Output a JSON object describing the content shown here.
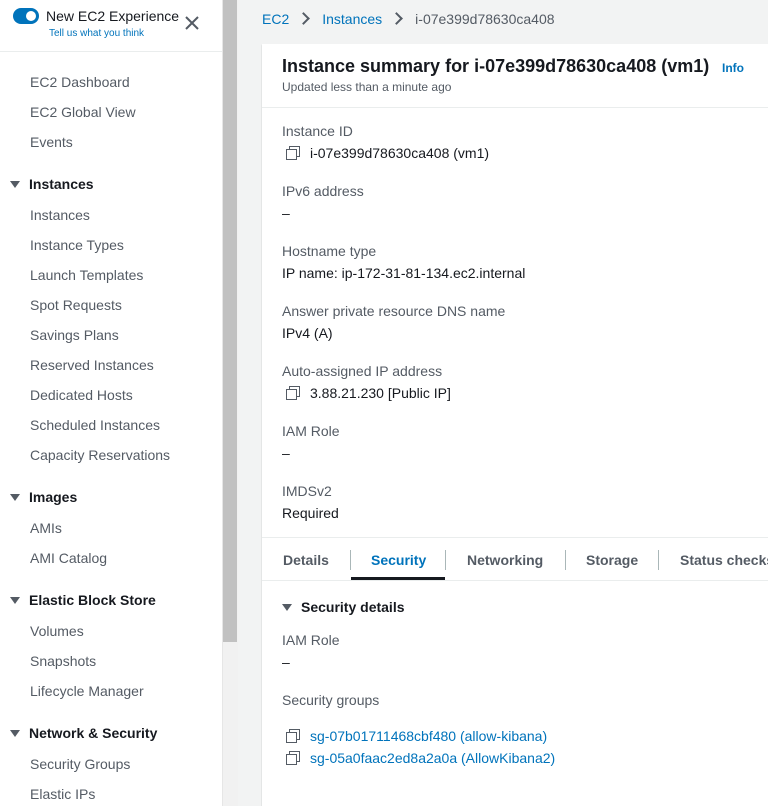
{
  "experience": {
    "title": "New EC2 Experience",
    "subtitle": "Tell us what you think"
  },
  "sidebar": {
    "items_top": [
      "EC2 Dashboard",
      "EC2 Global View",
      "Events"
    ],
    "instances": {
      "heading": "Instances",
      "items": [
        "Instances",
        "Instance Types",
        "Launch Templates",
        "Spot Requests",
        "Savings Plans",
        "Reserved Instances",
        "Dedicated Hosts",
        "Scheduled Instances",
        "Capacity Reservations"
      ]
    },
    "images": {
      "heading": "Images",
      "items": [
        "AMIs",
        "AMI Catalog"
      ]
    },
    "ebs": {
      "heading": "Elastic Block Store",
      "items": [
        "Volumes",
        "Snapshots",
        "Lifecycle Manager"
      ]
    },
    "network": {
      "heading": "Network & Security",
      "items": [
        "Security Groups",
        "Elastic IPs"
      ]
    }
  },
  "breadcrumb": [
    "EC2",
    "Instances",
    "i-07e399d78630ca408"
  ],
  "summary": {
    "title": "Instance summary for i-07e399d78630ca408 (vm1)",
    "info": "Info",
    "updated": "Updated less than a minute ago",
    "fields": [
      {
        "label": "Instance ID",
        "value": "i-07e399d78630ca408 (vm1)",
        "copy": true
      },
      {
        "label": "IPv6 address",
        "value": "–",
        "copy": false
      },
      {
        "label": "Hostname type",
        "value": "IP name: ip-172-31-81-134.ec2.internal",
        "copy": false
      },
      {
        "label": "Answer private resource DNS name",
        "value": "IPv4 (A)",
        "copy": false
      },
      {
        "label": "Auto-assigned IP address",
        "value": "3.88.21.230 [Public IP]",
        "copy": true
      },
      {
        "label": "IAM Role",
        "value": "–",
        "copy": false
      },
      {
        "label": "IMDSv2",
        "value": "Required",
        "copy": false
      }
    ]
  },
  "tabs": {
    "labels": [
      "Details",
      "Security",
      "Networking",
      "Storage",
      "Status checks"
    ],
    "active": "Security"
  },
  "security_details": {
    "heading": "Security details",
    "iam_role_label": "IAM Role",
    "iam_role_value": "–",
    "groups_label": "Security groups",
    "groups": [
      "sg-07b01711468cbf480 (allow-kibana)",
      "sg-05a0faac2ed8a2a0a (AllowKibana2)"
    ]
  }
}
